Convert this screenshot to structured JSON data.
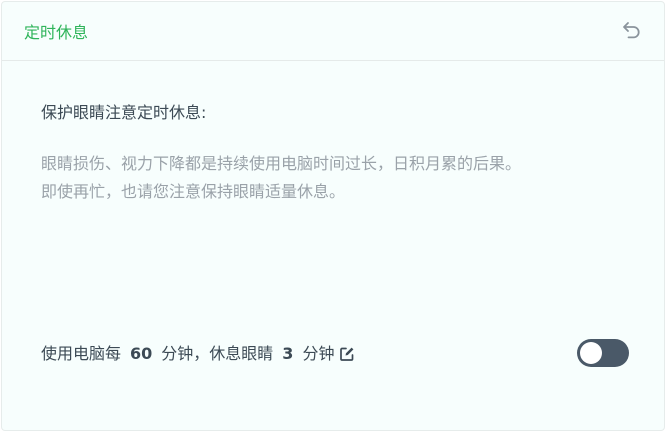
{
  "header": {
    "title": "定时休息",
    "back_icon": "undo-arrow-icon"
  },
  "main": {
    "section_title": "保护眼睛注意定时休息:",
    "description_lines": [
      "眼睛损伤、视力下降都是持续使用电脑时间过长，日积月累的后果。",
      "即使再忙，也请您注意保持眼睛适量休息。"
    ],
    "schedule": {
      "prefix": "使用电脑每",
      "work_minutes": "60",
      "unit1": "分钟，休息眼睛",
      "rest_minutes": "3",
      "unit2": "分钟",
      "edit_icon": "edit-icon"
    },
    "toggle": {
      "enabled": false
    }
  },
  "colors": {
    "accent": "#2fb45a",
    "toggle_track": "#4a5968",
    "text": "#3c4a55",
    "muted_text": "#9aa2a9",
    "background": "#f7fefd"
  }
}
